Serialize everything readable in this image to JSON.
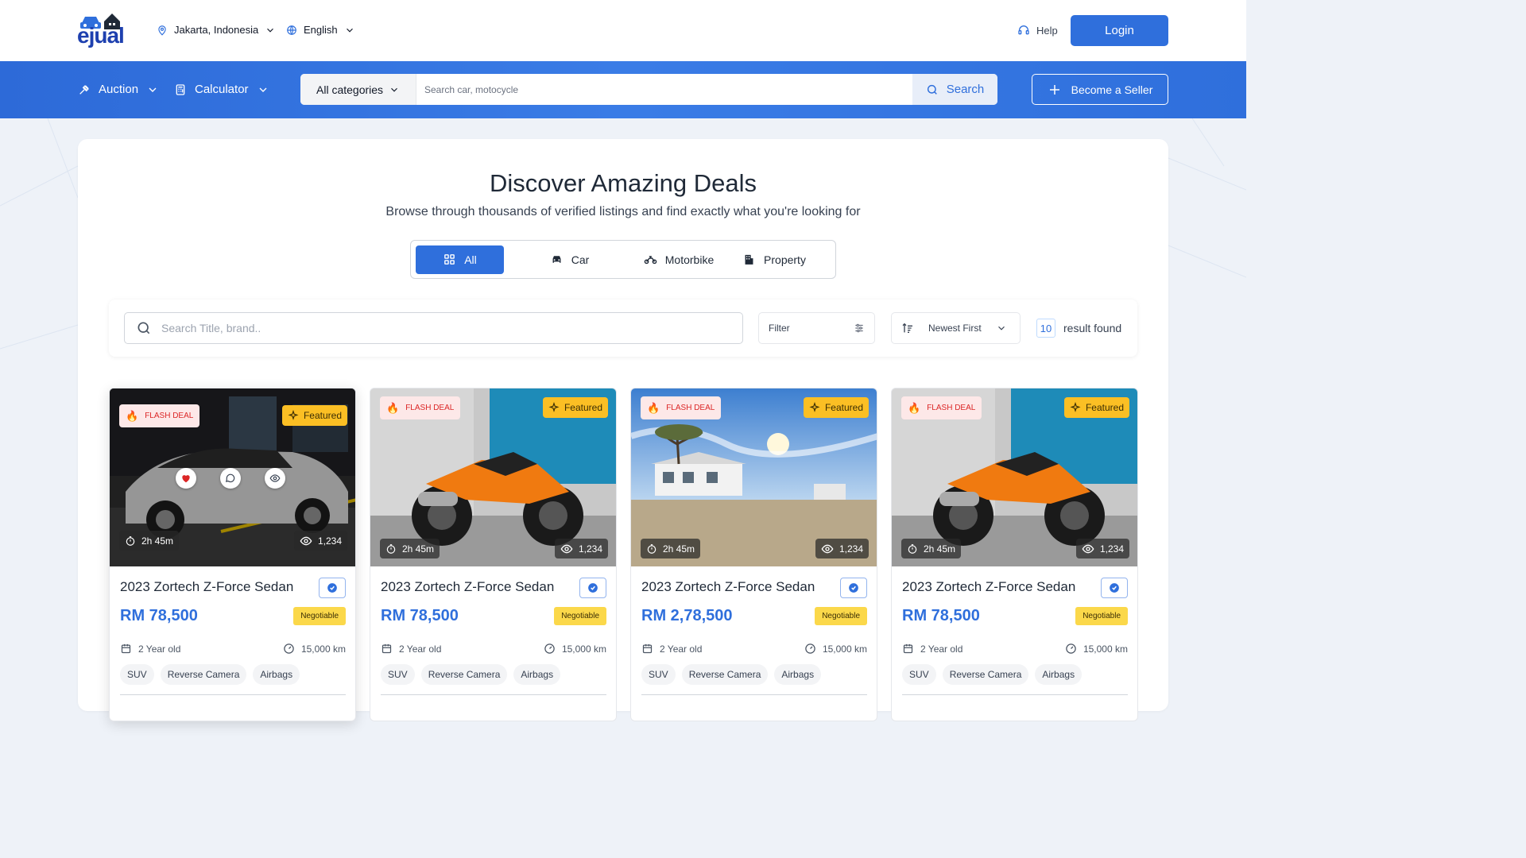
{
  "brand": {
    "logo_text": "ejual"
  },
  "topbar": {
    "location": "Jakarta, Indonesia",
    "language": "English",
    "help": "Help",
    "login": "Login"
  },
  "nav": {
    "auction": "Auction",
    "calculator": "Calculator",
    "category_select": "All categories",
    "search_placeholder": "Search car, motocycle",
    "search_button": "Search",
    "become_seller": "Become a Seller"
  },
  "hero": {
    "title": "Discover Amazing Deals",
    "subtitle": "Browse through thousands of verified listings and find exactly what you're looking for"
  },
  "tabs": [
    {
      "label": "All",
      "icon": "grid-icon",
      "active": true
    },
    {
      "label": "Car",
      "icon": "car-icon",
      "active": false
    },
    {
      "label": "Motorbike",
      "icon": "motorbike-icon",
      "active": false
    },
    {
      "label": "Property",
      "icon": "building-icon",
      "active": false
    }
  ],
  "filter_bar": {
    "search_placeholder": "Search Title, brand..",
    "filter_label": "Filter",
    "sort_label": "Newest First",
    "result_count": "10",
    "result_text": "result found"
  },
  "colors": {
    "accent": "#2f6fdc",
    "flash": "#dc2626",
    "featured": "#fbbf24",
    "negotiable": "#fbd84a"
  },
  "listings": [
    {
      "image": "car-photo",
      "flash_label": "FLASH DEAL",
      "featured_label": "Featured",
      "timer": "2h 45m",
      "views": "1,234",
      "title": "2023 Zortech Z-Force Sedan",
      "price": "RM 78,500",
      "negotiable": "Negotiable",
      "age": "2 Year old",
      "mileage": "15,000 km",
      "tags": [
        "SUV",
        "Reverse Camera",
        "Airbags"
      ]
    },
    {
      "image": "motorbike-photo",
      "flash_label": "FLASH DEAL",
      "featured_label": "Featured",
      "timer": "2h 45m",
      "views": "1,234",
      "title": "2023 Zortech Z-Force Sedan",
      "price": "RM 78,500",
      "negotiable": "Negotiable",
      "age": "2 Year old",
      "mileage": "15,000 km",
      "tags": [
        "SUV",
        "Reverse Camera",
        "Airbags"
      ]
    },
    {
      "image": "house-photo",
      "flash_label": "FLASH DEAL",
      "featured_label": "Featured",
      "timer": "2h 45m",
      "views": "1,234",
      "title": "2023 Zortech Z-Force Sedan",
      "price": "RM 2,78,500",
      "negotiable": "Negotiable",
      "age": "2 Year old",
      "mileage": "15,000 km",
      "tags": [
        "SUV",
        "Reverse Camera",
        "Airbags"
      ]
    },
    {
      "image": "motorbike-photo",
      "flash_label": "FLASH DEAL",
      "featured_label": "Featured",
      "timer": "2h 45m",
      "views": "1,234",
      "title": "2023 Zortech Z-Force Sedan",
      "price": "RM 78,500",
      "negotiable": "Negotiable",
      "age": "2 Year old",
      "mileage": "15,000 km",
      "tags": [
        "SUV",
        "Reverse Camera",
        "Airbags"
      ]
    }
  ]
}
